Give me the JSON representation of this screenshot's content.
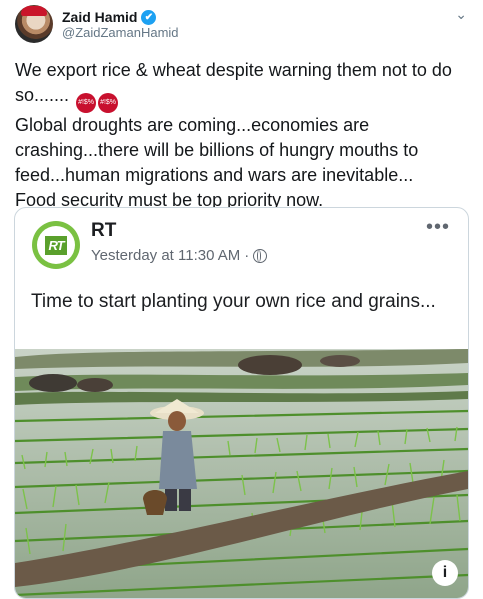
{
  "tweet": {
    "author_name": "Zaid Hamid",
    "handle": "@ZaidZamanHamid",
    "verified_glyph": "✔",
    "dropdown_glyph": "⌄",
    "text_lines": [
      "We export rice & wheat despite warning them not to do so.......",
      "Global droughts are coming...economies are crashing...there will be billions of hungry mouths to feed...human migrations and wars are inevitable...",
      "Food security must be top priority now."
    ],
    "emoji_icon": "enraged-face-emoji"
  },
  "embedded_post": {
    "page_name": "RT",
    "logo_text": "RT",
    "timestamp": "Yesterday at 11:30 AM",
    "separator": "·",
    "more_glyph": "•••",
    "text": "Time to start planting your own rice and grains...",
    "info_glyph": "i"
  },
  "colors": {
    "accent": "#1da1f2",
    "rt_green": "#7ac142"
  }
}
